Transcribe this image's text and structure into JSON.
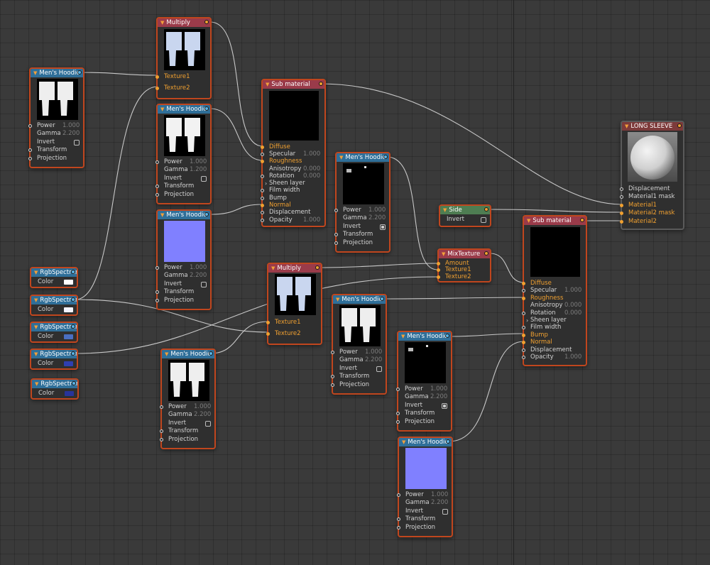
{
  "colors": {
    "background": "#3a3a3a",
    "node_border": "#c0461e",
    "header_material": "#9a3b4a",
    "header_image": "#2f6f99",
    "header_side": "#4e7d52",
    "pin_accent": "#f0a030",
    "wire": "#d8d8d8"
  },
  "image_params": {
    "power_label": "Power",
    "gamma_label": "Gamma",
    "invert_label": "Invert",
    "transform_label": "Transform",
    "projection_label": "Projection"
  },
  "nodes": {
    "multiply1": {
      "title": "Multiply",
      "texture1": "Texture1",
      "texture2": "Texture2"
    },
    "multiply2": {
      "title": "Multiply",
      "texture1": "Texture1",
      "texture2": "Texture2"
    },
    "hoodie_a": {
      "title": "Men's Hoodie",
      "power": "1.000",
      "gamma": "2.200",
      "invert": false
    },
    "hoodie_b": {
      "title": "Men's Hoodie",
      "power": "1.000",
      "gamma": "1.200",
      "invert": false
    },
    "hoodie_c": {
      "title": "Men's Hoodie",
      "power": "1.000",
      "gamma": "2.200",
      "invert": false
    },
    "hoodie_d": {
      "title": "Men's Hoodie",
      "power": "1.000",
      "gamma": "2.200",
      "invert": true
    },
    "hoodie_e": {
      "title": "Men's Hoodie",
      "power": "1.000",
      "gamma": "2.200",
      "invert": false
    },
    "hoodie_f": {
      "title": "Men's Hoodie",
      "power": "1.000",
      "gamma": "2.200",
      "invert": false
    },
    "hoodie_g": {
      "title": "Men's Hoodie",
      "power": "1.000",
      "gamma": "2.200",
      "invert": true
    },
    "hoodie_h": {
      "title": "Men's Hoodie",
      "power": "1.000",
      "gamma": "2.200",
      "invert": false
    },
    "submat1": {
      "title": "Sub material",
      "diffuse": "Diffuse",
      "specular": "Specular",
      "specular_val": "1.000",
      "roughness": "Roughness",
      "anisotropy": "Anisotropy",
      "anisotropy_val": "0.000",
      "rotation": "Rotation",
      "rotation_val": "0.000",
      "sheen": "Sheen layer",
      "film": "Film width",
      "bump": "Bump",
      "normal": "Normal",
      "displacement": "Displacement",
      "opacity": "Opacity",
      "opacity_val": "1.000"
    },
    "submat2": {
      "title": "Sub material",
      "diffuse": "Diffuse",
      "specular": "Specular",
      "specular_val": "1.000",
      "roughness": "Roughness",
      "anisotropy": "Anisotropy",
      "anisotropy_val": "0.000",
      "rotation": "Rotation",
      "rotation_val": "0.000",
      "sheen": "Sheen layer",
      "film": "Film width",
      "bump": "Bump",
      "normal": "Normal",
      "displacement": "Displacement",
      "opacity": "Opacity",
      "opacity_val": "1.000"
    },
    "mixtexture": {
      "title": "MixTexture",
      "amount": "Amount",
      "texture1": "Texture1",
      "texture2": "Texture2"
    },
    "side": {
      "title": "Side",
      "invert": "Invert"
    },
    "long_sleeve": {
      "title": "LONG SLEEVE",
      "displacement": "Displacement",
      "material1_mask": "Material1 mask",
      "material1": "Material1",
      "material2_mask": "Material2 mask",
      "material2": "Material2"
    },
    "rgb1": {
      "title": "RgbSpectrum",
      "color_label": "Color",
      "swatch": "#ffffff"
    },
    "rgb2": {
      "title": "RgbSpectrum",
      "color_label": "Color",
      "swatch": "#f4f4ff"
    },
    "rgb3": {
      "title": "RgbSpectrum",
      "color_label": "Color",
      "swatch": "#4a6fc2"
    },
    "rgb4": {
      "title": "RgbSpectrum",
      "color_label": "Color",
      "swatch": "#2f3fb0"
    },
    "rgb5": {
      "title": "RgbSpectrum",
      "color_label": "Color",
      "swatch": "#27349a"
    }
  }
}
